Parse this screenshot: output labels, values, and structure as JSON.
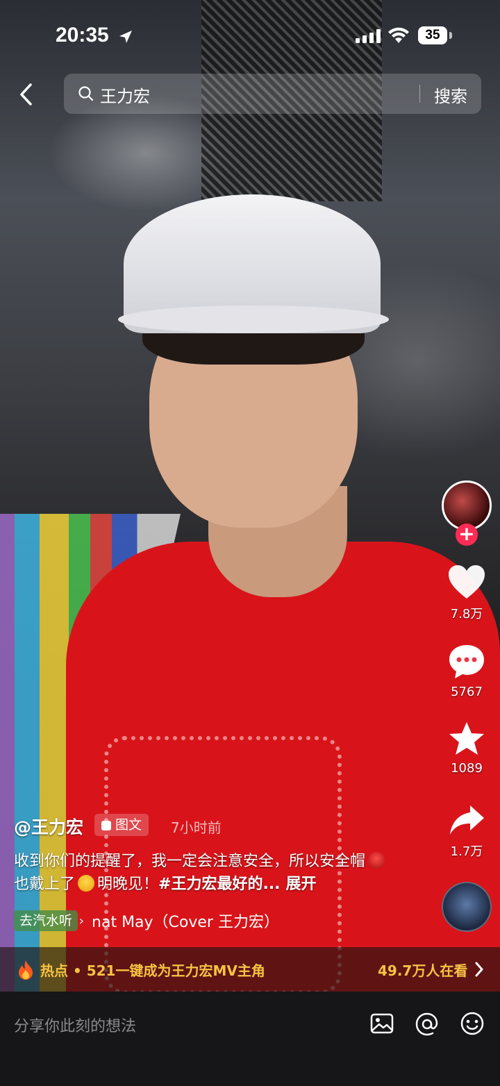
{
  "status_bar": {
    "time": "20:35",
    "battery": "35"
  },
  "search": {
    "query": "王力宏",
    "button_label": "搜索"
  },
  "side_actions": {
    "likes": "7.8万",
    "comments": "5767",
    "favorites": "1089",
    "shares": "1.7万"
  },
  "post": {
    "author": "@王力宏",
    "type_badge": "图文",
    "time_ago": "7小时前",
    "caption_part1": "收到你们的提醒了，我一定会注意安全，所以安全帽",
    "caption_part2": "也戴上了",
    "caption_part3": "明晚见！",
    "hashtag": "#王力宏最好的...",
    "expand_label": "展开",
    "music_chip": "去汽水听",
    "music_title": "nat May（Cover 王力宏）"
  },
  "hot_bar": {
    "label": "热点 • 521一键成为王力宏MV主角",
    "viewers": "49.7万人在看"
  },
  "comment_bar": {
    "placeholder": "分享你此刻的想法"
  },
  "icons": [
    "location-arrow-icon",
    "signal-icon",
    "wifi-icon",
    "back-chevron-icon",
    "search-icon",
    "plus-icon",
    "heart-icon",
    "comment-icon",
    "star-icon",
    "share-icon",
    "fire-icon",
    "chevron-right-icon",
    "image-icon",
    "at-icon",
    "emoji-icon"
  ],
  "colors": {
    "accent_red": "#fe2c55",
    "hot_yellow": "#f6c343"
  }
}
